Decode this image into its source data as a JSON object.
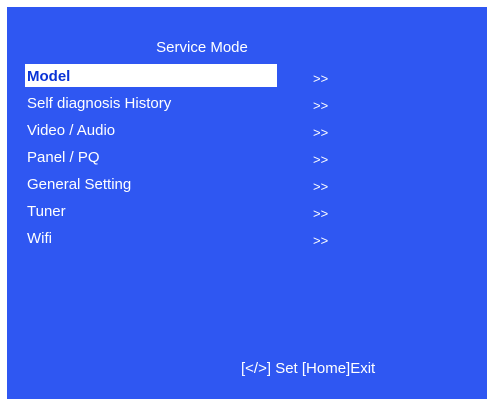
{
  "header": {
    "title": "Service Mode"
  },
  "menu": {
    "selected_index": 0,
    "items": [
      {
        "label": "Model",
        "arrow": ">>"
      },
      {
        "label": "Self diagnosis History",
        "arrow": ">>"
      },
      {
        "label": "Video / Audio",
        "arrow": ">>"
      },
      {
        "label": "Panel / PQ",
        "arrow": ">>"
      },
      {
        "label": "General Setting",
        "arrow": ">>"
      },
      {
        "label": "Tuner",
        "arrow": ">>"
      },
      {
        "label": "Wifi",
        "arrow": ">>"
      }
    ]
  },
  "footer": {
    "hint": "[</>] Set [Home]Exit"
  },
  "colors": {
    "panel_background": "#2f57f2",
    "text": "#ffffff",
    "highlight_background": "#ffffff",
    "highlight_text": "#0a33d6"
  }
}
